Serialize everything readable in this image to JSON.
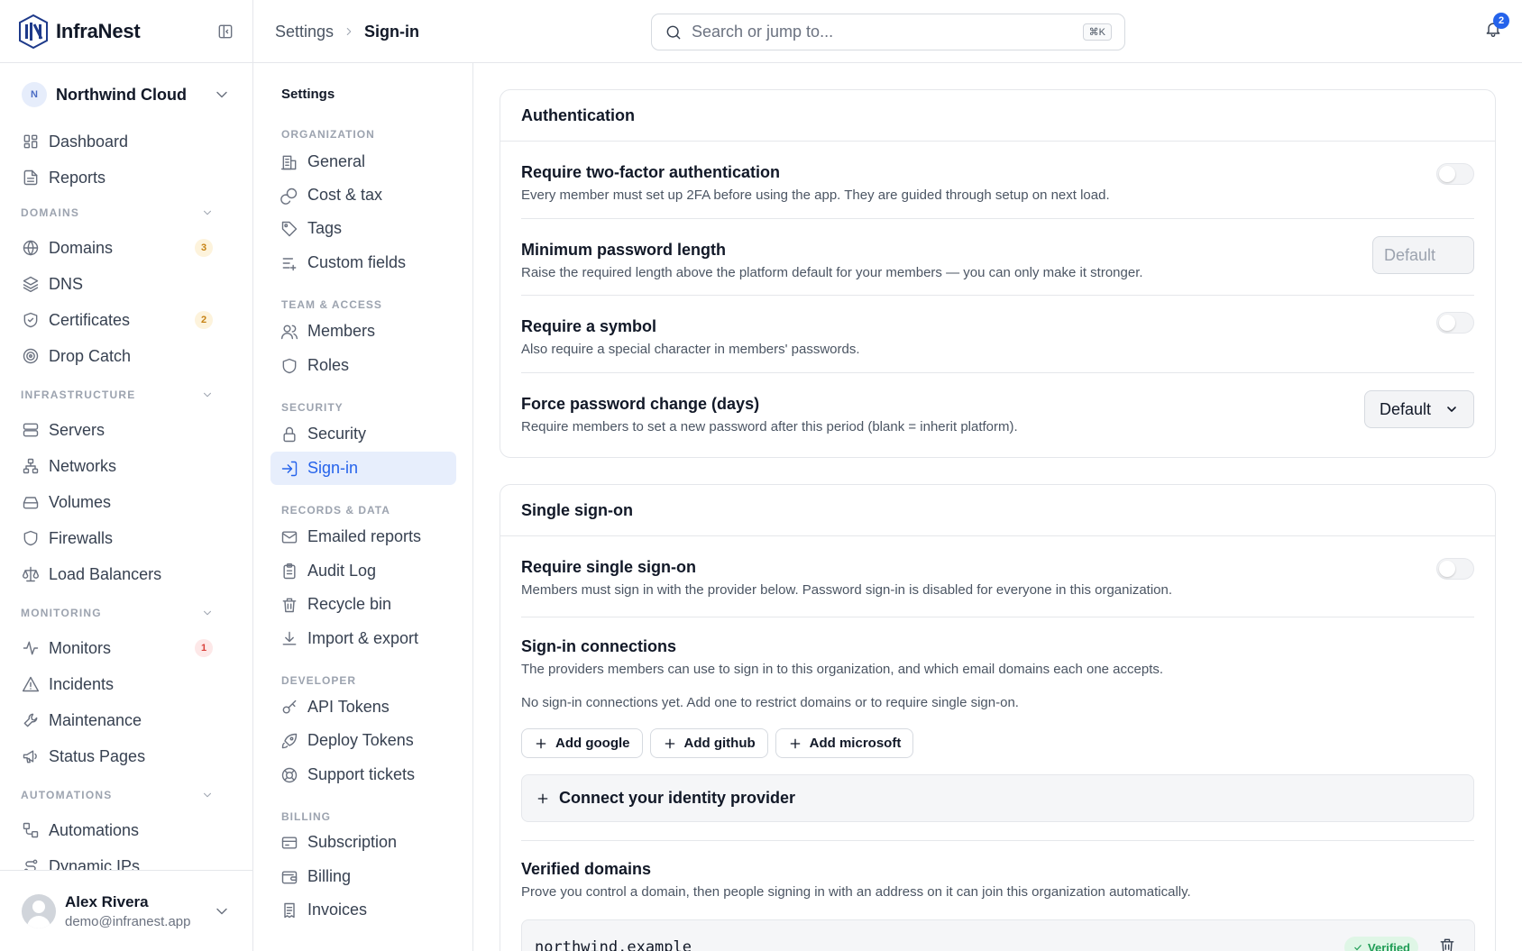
{
  "brand": {
    "name": "InfraNest"
  },
  "org": {
    "initial": "N",
    "name": "Northwind Cloud"
  },
  "sidebar": {
    "top_items": [
      {
        "label": "Dashboard",
        "icon": "dashboard-icon"
      },
      {
        "label": "Reports",
        "icon": "reports-icon"
      }
    ],
    "sections": [
      {
        "title": "DOMAINS",
        "items": [
          {
            "label": "Domains",
            "icon": "globe-icon",
            "badge": "3",
            "badge_color": "#c68213"
          },
          {
            "label": "DNS",
            "icon": "layers-icon"
          },
          {
            "label": "Certificates",
            "icon": "shield-check-icon",
            "badge": "2",
            "badge_color": "#c68213"
          },
          {
            "label": "Drop Catch",
            "icon": "target-icon"
          }
        ]
      },
      {
        "title": "INFRASTRUCTURE",
        "items": [
          {
            "label": "Servers",
            "icon": "server-icon"
          },
          {
            "label": "Networks",
            "icon": "network-icon"
          },
          {
            "label": "Volumes",
            "icon": "drive-icon"
          },
          {
            "label": "Firewalls",
            "icon": "shield-icon"
          },
          {
            "label": "Load Balancers",
            "icon": "scale-icon"
          }
        ]
      },
      {
        "title": "MONITORING",
        "items": [
          {
            "label": "Monitors",
            "icon": "activity-icon",
            "badge": "1",
            "badge_color": "#d9413b"
          },
          {
            "label": "Incidents",
            "icon": "alert-triangle-icon"
          },
          {
            "label": "Maintenance",
            "icon": "wrench-icon"
          },
          {
            "label": "Status Pages",
            "icon": "megaphone-icon"
          }
        ]
      },
      {
        "title": "AUTOMATIONS",
        "items": [
          {
            "label": "Automations",
            "icon": "workflow-icon"
          },
          {
            "label": "Dynamic IPs",
            "icon": "route-icon"
          }
        ]
      }
    ]
  },
  "user": {
    "name": "Alex Rivera",
    "email": "demo@infranest.app"
  },
  "topbar": {
    "breadcrumb": [
      "Settings",
      "Sign-in"
    ],
    "search_placeholder": "Search or jump to...",
    "search_shortcut": "⌘K",
    "notification_count": "2"
  },
  "settings_nav": {
    "title": "Settings",
    "sections": [
      {
        "title": "ORGANIZATION",
        "items": [
          {
            "label": "General",
            "icon": "building-icon"
          },
          {
            "label": "Cost & tax",
            "icon": "coins-icon"
          },
          {
            "label": "Tags",
            "icon": "tag-icon"
          },
          {
            "label": "Custom fields",
            "icon": "list-plus-icon"
          }
        ]
      },
      {
        "title": "TEAM & ACCESS",
        "items": [
          {
            "label": "Members",
            "icon": "users-icon"
          },
          {
            "label": "Roles",
            "icon": "shield-icon"
          }
        ]
      },
      {
        "title": "SECURITY",
        "items": [
          {
            "label": "Security",
            "icon": "lock-icon"
          },
          {
            "label": "Sign-in",
            "icon": "log-in-icon",
            "active": true
          }
        ]
      },
      {
        "title": "RECORDS & DATA",
        "items": [
          {
            "label": "Emailed reports",
            "icon": "mail-icon"
          },
          {
            "label": "Audit Log",
            "icon": "clipboard-icon"
          },
          {
            "label": "Recycle bin",
            "icon": "trash-icon"
          },
          {
            "label": "Import & export",
            "icon": "download-icon"
          }
        ]
      },
      {
        "title": "DEVELOPER",
        "items": [
          {
            "label": "API Tokens",
            "icon": "key-icon"
          },
          {
            "label": "Deploy Tokens",
            "icon": "rocket-icon"
          },
          {
            "label": "Support tickets",
            "icon": "lifebuoy-icon"
          }
        ]
      },
      {
        "title": "BILLING",
        "items": [
          {
            "label": "Subscription",
            "icon": "credit-card-icon"
          },
          {
            "label": "Billing",
            "icon": "wallet-icon"
          },
          {
            "label": "Invoices",
            "icon": "receipt-icon"
          }
        ]
      }
    ]
  },
  "auth_card": {
    "title": "Authentication",
    "two_factor": {
      "title": "Require two-factor authentication",
      "desc": "Every member must set up 2FA before using the app. They are guided through setup on next load.",
      "enabled": false
    },
    "min_length": {
      "title": "Minimum password length",
      "desc": "Raise the required length above the platform default for your members — you can only make it stronger.",
      "placeholder": "Default"
    },
    "symbol": {
      "title": "Require a symbol",
      "desc": "Also require a special character in members' passwords.",
      "enabled": false
    },
    "force_change": {
      "title": "Force password change (days)",
      "desc": "Require members to set a new password after this period (blank = inherit platform).",
      "value": "Default"
    }
  },
  "sso_card": {
    "title": "Single sign-on",
    "require_sso": {
      "title": "Require single sign-on",
      "desc": "Members must sign in with the provider below. Password sign-in is disabled for everyone in this organization.",
      "enabled": false
    },
    "connections": {
      "title": "Sign-in connections",
      "desc": "The providers members can use to sign in to this organization, and which email domains each one accepts.",
      "empty": "No sign-in connections yet. Add one to restrict domains or to require single sign-on.",
      "buttons": [
        "Add google",
        "Add github",
        "Add microsoft"
      ],
      "idp_label": "Connect your identity provider"
    },
    "verified_domains": {
      "title": "Verified domains",
      "desc": "Prove you control a domain, then people signing in with an address on it can join this organization automatically.",
      "domains": [
        {
          "name": "northwind.example",
          "status": "Verified"
        }
      ]
    }
  },
  "colors": {
    "accent": "#2563eb",
    "active_bg": "#e7eefc",
    "success": "#1f9d55"
  }
}
